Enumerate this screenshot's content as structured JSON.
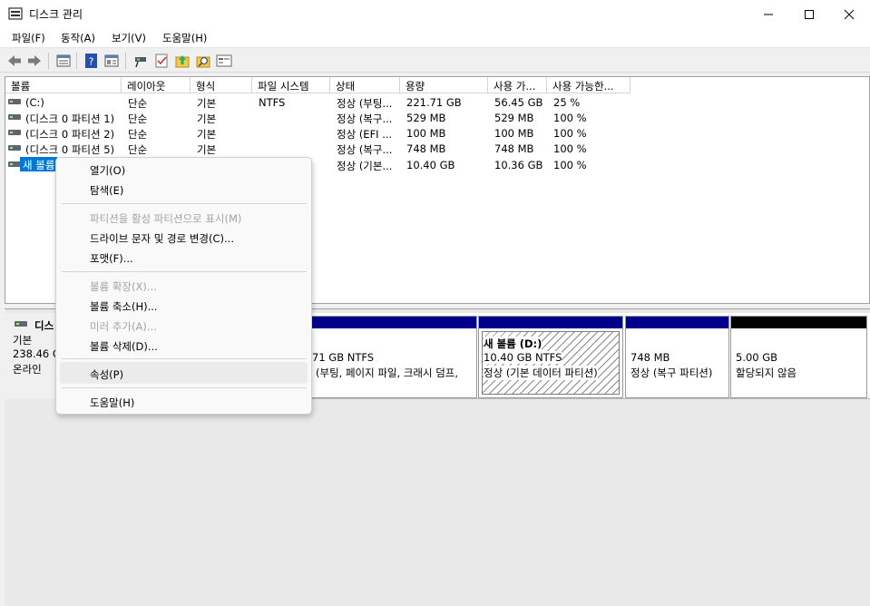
{
  "window": {
    "title": "디스크 관리"
  },
  "menu": [
    "파일(F)",
    "동작(A)",
    "보기(V)",
    "도움말(H)"
  ],
  "toolbar": [
    "back-arrow-icon",
    "forward-arrow-icon",
    "disk-list-icon",
    "help-icon",
    "properties-icon",
    "connect-icon",
    "check-icon",
    "rescan-icon",
    "find-icon",
    "settings-icon"
  ],
  "volume_table": {
    "columns": [
      "볼륨",
      "레이아웃",
      "형식",
      "파일 시스템",
      "상태",
      "용량",
      "사용 가...",
      "사용 가능한..."
    ],
    "rows": [
      [
        "(C:)",
        "단순",
        "기본",
        "NTFS",
        "정상 (부팅...",
        "221.71 GB",
        "56.45 GB",
        "25 %"
      ],
      [
        "(디스크 0 파티션 1)",
        "단순",
        "기본",
        "",
        "정상 (복구...",
        "529 MB",
        "529 MB",
        "100 %"
      ],
      [
        "(디스크 0 파티션 2)",
        "단순",
        "기본",
        "",
        "정상 (EFI ...",
        "100 MB",
        "100 MB",
        "100 %"
      ],
      [
        "(디스크 0 파티션 5)",
        "단순",
        "기본",
        "",
        "정상 (복구...",
        "748 MB",
        "748 MB",
        "100 %"
      ],
      [
        "새 볼륨",
        "",
        "",
        "",
        "정상 (기본...",
        "10.40 GB",
        "10.36 GB",
        "100 %"
      ]
    ]
  },
  "disk0": {
    "name": "디스",
    "type": "기본",
    "size": "238.46 G",
    "status": "온라인",
    "partitions": [
      {
        "line1": "",
        "line2": "71 GB NTFS",
        "line3": "(부팅, 페이지 파일, 크래시 덤프,"
      },
      {
        "line1": "새 볼륨  (D:)",
        "line2": "10.40 GB NTFS",
        "line3": "정상 (기본 데이터 파티션)"
      },
      {
        "line1": "",
        "line2": "748 MB",
        "line3": "정상 (복구 파티션)"
      },
      {
        "line1": "",
        "line2": "5.00 GB",
        "line3": "할당되지 않음"
      }
    ]
  },
  "context_menu": {
    "items": [
      {
        "label": "열기(O)",
        "enabled": true
      },
      {
        "label": "탐색(E)",
        "enabled": true
      },
      {
        "label": "파티션을 활성 파티션으로 표시(M)",
        "enabled": false
      },
      {
        "label": "드라이브 문자 및 경로 변경(C)...",
        "enabled": true
      },
      {
        "label": "포맷(F)...",
        "enabled": true
      },
      {
        "label": "볼륨 확장(X)...",
        "enabled": false
      },
      {
        "label": "볼륨 축소(H)...",
        "enabled": true
      },
      {
        "label": "미러 추가(A)...",
        "enabled": false
      },
      {
        "label": "볼륨 삭제(D)...",
        "enabled": true
      },
      {
        "label": "속성(P)",
        "enabled": true
      },
      {
        "label": "도움말(H)",
        "enabled": true
      }
    ]
  },
  "colors": {
    "primary_partition": "#02008b",
    "unallocated": "#000000",
    "selection": "#0078d7"
  }
}
